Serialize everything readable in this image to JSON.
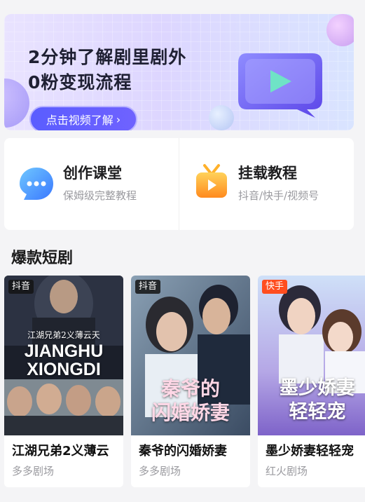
{
  "banner": {
    "title_line1": "2分钟了解剧里剧外",
    "title_line2": "0粉变现流程",
    "button_label": "点击视频了解",
    "button_icon": "chevron-right-icon",
    "art_icon": "video-play-icon"
  },
  "features": [
    {
      "title": "创作课堂",
      "subtitle": "保姆级完整教程",
      "icon": "chat-bubble-icon"
    },
    {
      "title": "挂载教程",
      "subtitle": "抖音/快手/视频号",
      "icon": "tv-play-icon"
    }
  ],
  "section": {
    "title": "爆款短剧"
  },
  "dramas": [
    {
      "title": "江湖兄弟2义薄云",
      "studio": "多多剧场",
      "platform": "抖音",
      "poster_text": [
        "JIANGHU",
        "XIONGDI"
      ],
      "poster_calligraphy": "江湖兄弟2义薄云天"
    },
    {
      "title": "秦爷的闪婚娇妻",
      "studio": "多多剧场",
      "platform": "抖音",
      "poster_text": [
        "秦爷的",
        "闪婚娇妻"
      ]
    },
    {
      "title": "墨少娇妻轻轻宠",
      "studio": "红火剧场",
      "platform": "快手",
      "poster_text": [
        "墨少娇妻",
        "轻轻宠"
      ]
    }
  ],
  "colors": {
    "accent": "#5a5dff",
    "kuaishou_tag": "#ff4d1f",
    "douyin_tag": "#1a1a1a"
  }
}
